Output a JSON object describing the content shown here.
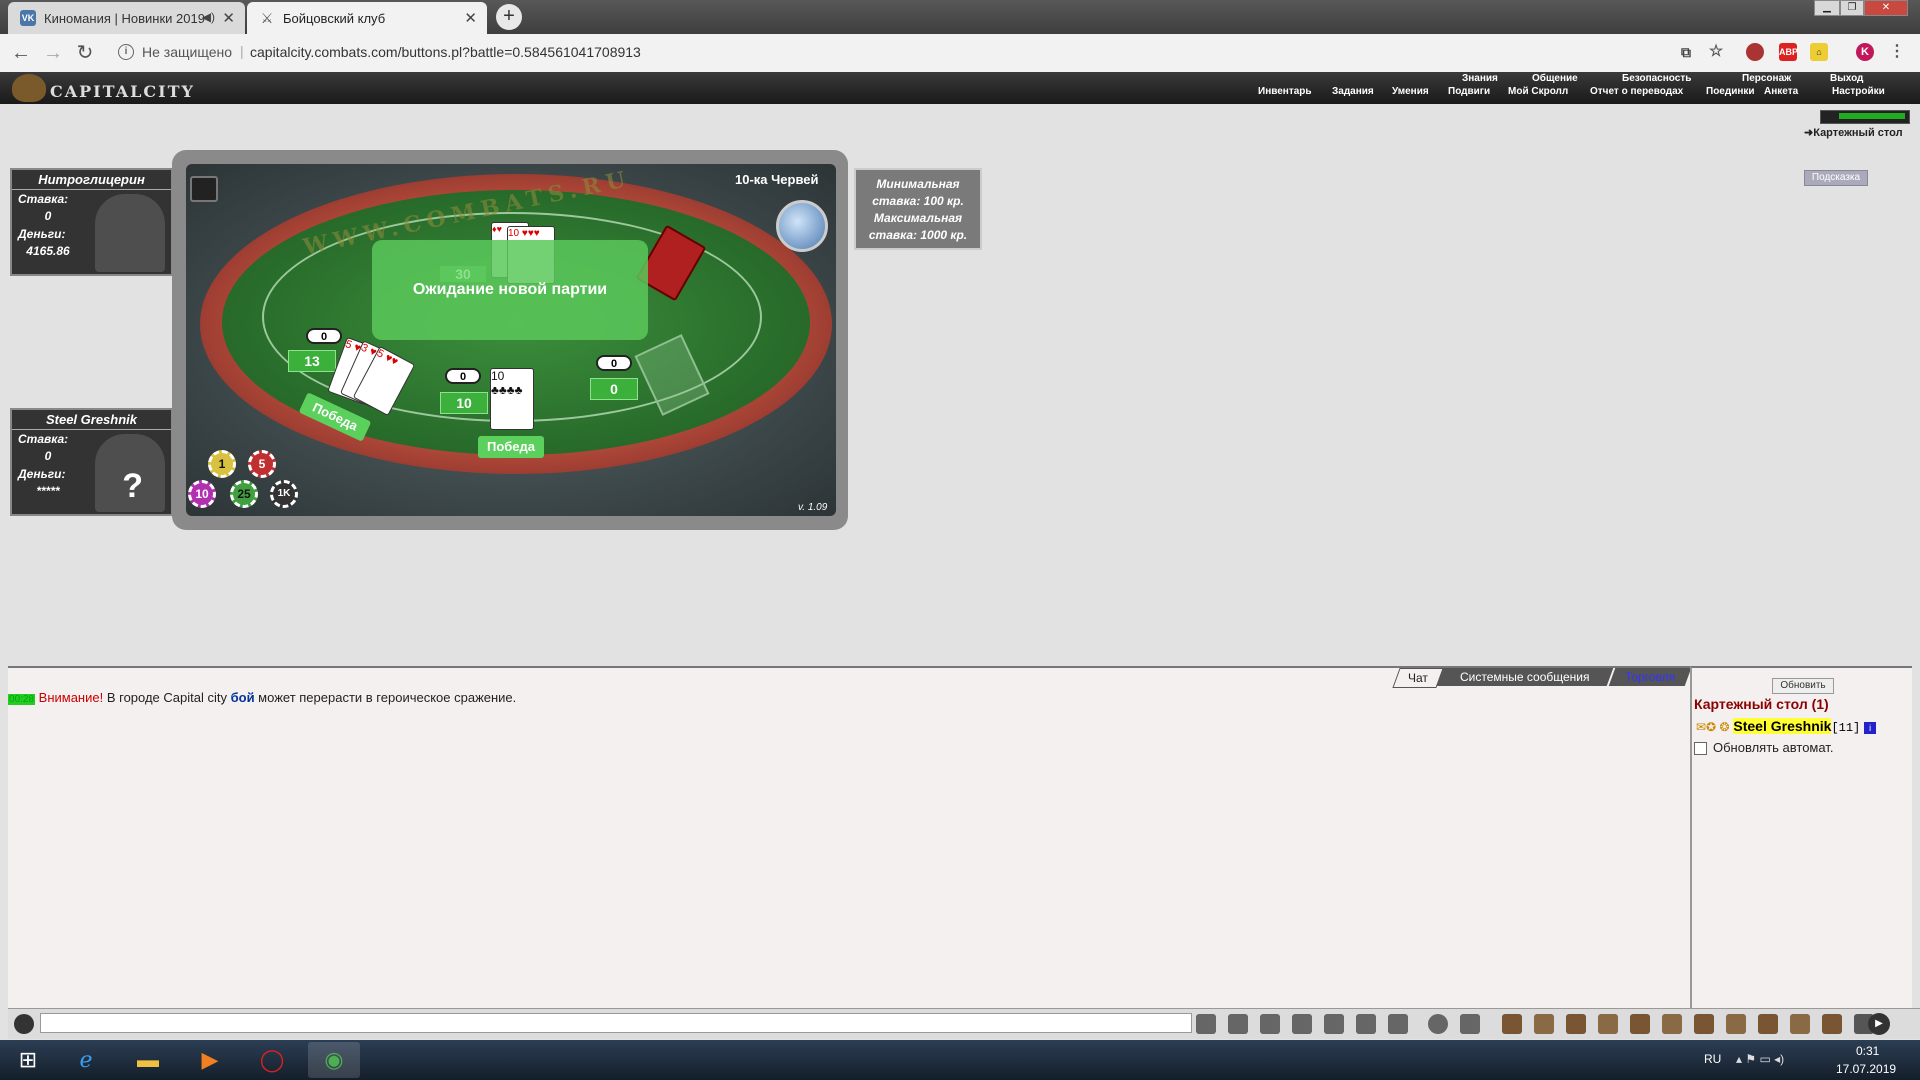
{
  "browser": {
    "tabs": [
      {
        "title": "Киномания | Новинки 2019",
        "favicon": "vk-icon"
      },
      {
        "title": "Бойцовский клуб",
        "favicon": "swords-icon"
      }
    ],
    "security": "Не защищено",
    "url": "capitalcity.combats.com/buttons.pl?battle=0.584561041708913",
    "profile_letter": "K"
  },
  "game": {
    "logo": "CAPITALCITY",
    "top_menu": [
      "Знания",
      "Общение",
      "Безопасность",
      "Персонаж",
      "Выход"
    ],
    "sub_menu": [
      "Инвентарь",
      "Задания",
      "Умения",
      "Подвиги",
      "Мой Скролл",
      "Отчет о переводах",
      "Поединки",
      "Анкета",
      "Настройки"
    ],
    "location": "Картежный стол",
    "hint_button": "Подсказка"
  },
  "players": [
    {
      "name": "Нитроглицерин",
      "stake_label": "Ставка:",
      "stake": "0",
      "money_label": "Деньги:",
      "money": "4165.86"
    },
    {
      "name": "Steel Greshnik",
      "stake_label": "Ставка:",
      "stake": "0",
      "money_label": "Деньги:",
      "money": "*****",
      "unknown": "?"
    }
  ],
  "table": {
    "trump": "10-ка Червей",
    "website": "WWW.COMBATS.RU",
    "status": "Ожидание новой партии",
    "pot": "30",
    "version": "v. 1.09",
    "hands": [
      {
        "bet": "0",
        "score": "13",
        "result": "Победа"
      },
      {
        "bet": "0",
        "score": "10",
        "result": "Победа"
      },
      {
        "bet": "0",
        "score": "0"
      }
    ],
    "chips": [
      "1",
      "5",
      "10",
      "25",
      "1K"
    ]
  },
  "stakes": {
    "line1": "Минимальная",
    "line2": "ставка:   100 кр.",
    "line3": "Максимальная",
    "line4": "ставка:  1000 кр."
  },
  "chat": {
    "tabs": [
      "Чат",
      "Системные сообщения",
      "Торговля"
    ],
    "message": {
      "time": "00:28",
      "warning": "Внимание!",
      "text1": " В городе Capital city ",
      "highlight": "бой",
      "text2": " может перерасти в героическое сражение."
    }
  },
  "side": {
    "refresh_button": "Обновить",
    "room_title": "Картежный стол (1)",
    "user_name": "Steel Greshnik",
    "user_level": "[11]",
    "auto_refresh_label": "Обновлять автомат."
  },
  "taskbar": {
    "lang": "RU",
    "time": "0:31",
    "date": "17.07.2019"
  },
  "colors": {
    "felt": "#2f7a32",
    "highlight_yellow": "#ffff33",
    "warning_red": "#cc0000",
    "room_title": "#8b0000"
  }
}
